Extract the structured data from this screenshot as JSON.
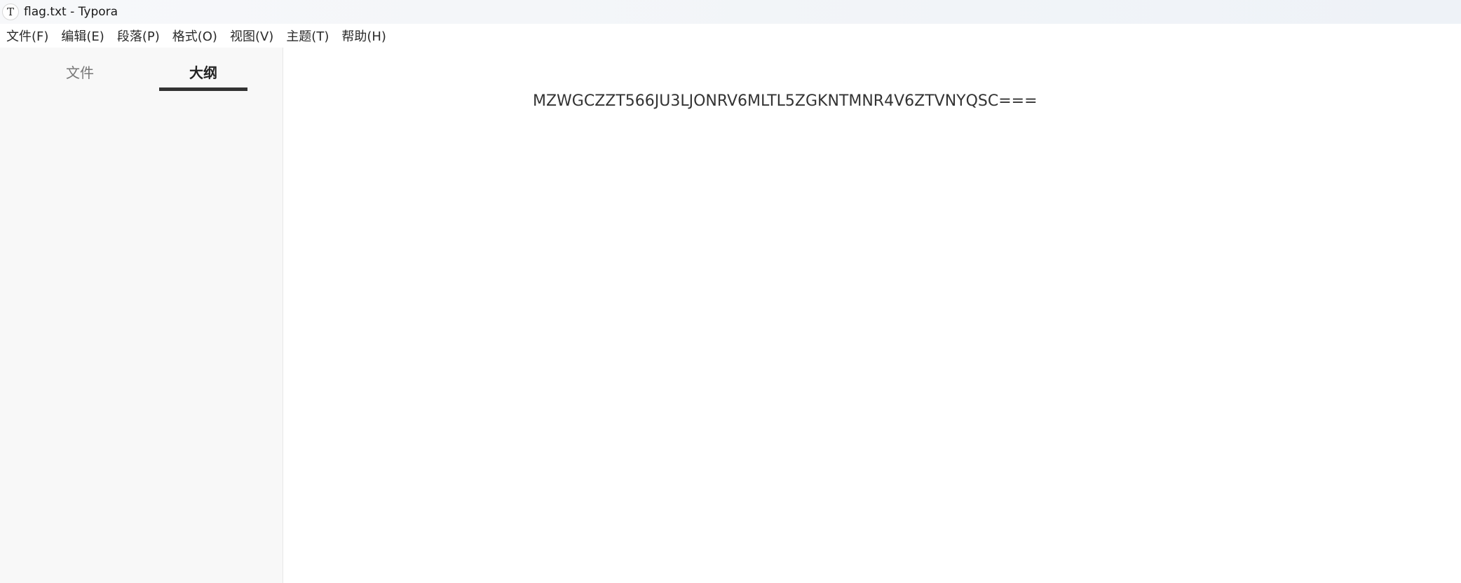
{
  "window": {
    "title": "flag.txt - Typora",
    "icon": "T"
  },
  "menubar": {
    "items": [
      {
        "label": "文件(F)"
      },
      {
        "label": "编辑(E)"
      },
      {
        "label": "段落(P)"
      },
      {
        "label": "格式(O)"
      },
      {
        "label": "视图(V)"
      },
      {
        "label": "主题(T)"
      },
      {
        "label": "帮助(H)"
      }
    ]
  },
  "sidebar": {
    "tabs": [
      {
        "label": "文件",
        "active": false
      },
      {
        "label": "大纲",
        "active": true
      }
    ]
  },
  "editor": {
    "content": "MZWGCZZT566JU3LJONRV6MLTL5ZGKNTMNR4V6ZTVNYQSC==="
  }
}
